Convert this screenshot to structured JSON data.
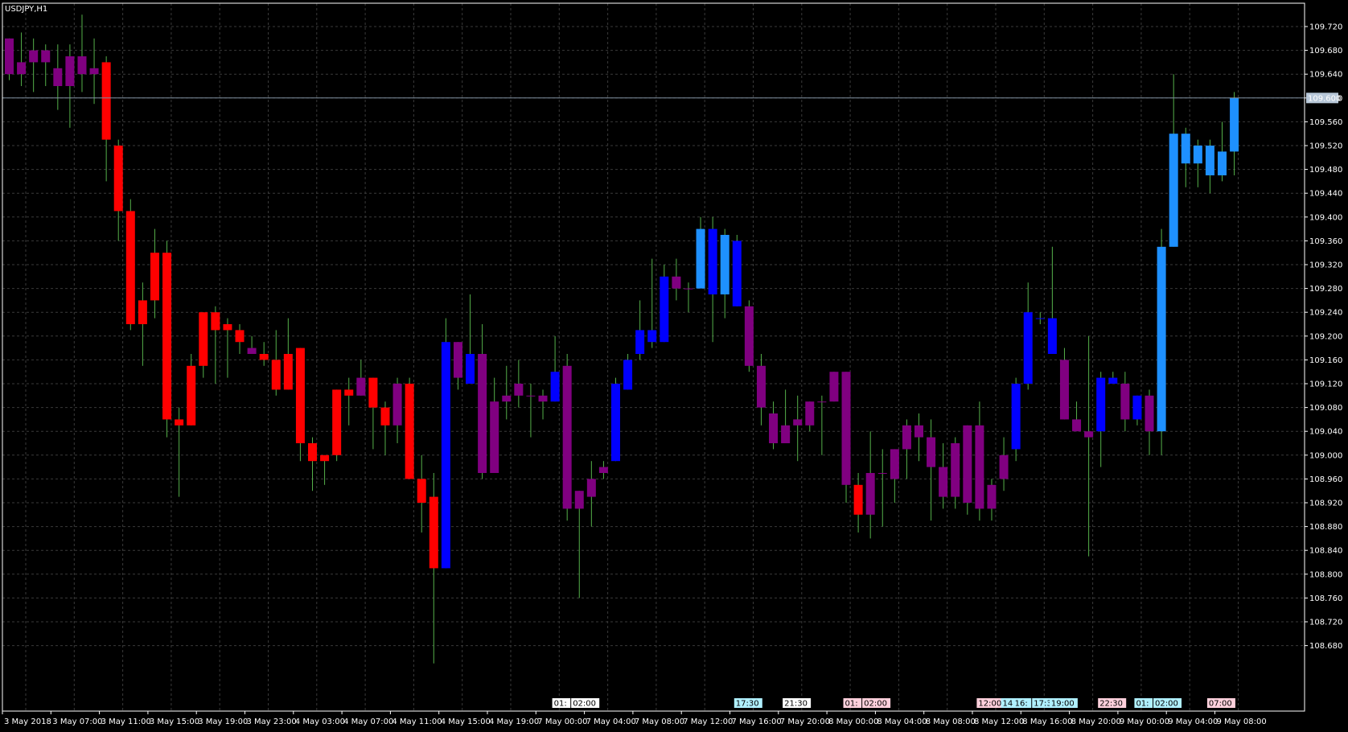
{
  "symbol_label": "USDJPY,H1",
  "current_price_label": "109.600",
  "colors": {
    "background": "#000000",
    "grid": "#3a3a3a",
    "axis": "#ffffff",
    "text": "#ffffff",
    "wick": "#55b04a",
    "bid_line": "#7f8f9f",
    "price_tag_bg": "#b7c7d8",
    "price_tag_text": "#000000",
    "candle_bear_strong": "#ff0000",
    "candle_bull_strong": "#0000ff",
    "candle_bull_light": "#1e90ff",
    "candle_neutral": "#800080"
  },
  "chart_data": {
    "type": "candlestick",
    "title": "USDJPY,H1",
    "ylim": [
      108.64,
      109.74
    ],
    "grid": true,
    "y_ticks": [
      "109.720",
      "109.680",
      "109.640",
      "109.600",
      "109.560",
      "109.520",
      "109.480",
      "109.440",
      "109.400",
      "109.360",
      "109.320",
      "109.280",
      "109.240",
      "109.200",
      "109.160",
      "109.120",
      "109.080",
      "109.040",
      "109.000",
      "108.960",
      "108.920",
      "108.880",
      "108.840",
      "108.800",
      "108.760",
      "108.720",
      "108.680"
    ],
    "x_labels": [
      "3 May 2018",
      "3 May 07:00",
      "3 May 11:00",
      "3 May 15:00",
      "3 May 19:00",
      "3 May 23:00",
      "4 May 03:00",
      "4 May 07:00",
      "4 May 11:00",
      "4 May 15:00",
      "4 May 19:00",
      "7 May 00:00",
      "7 May 04:00",
      "7 May 08:00",
      "7 May 12:00",
      "7 May 16:00",
      "7 May 20:00",
      "8 May 00:00",
      "8 May 04:00",
      "8 May 08:00",
      "8 May 12:00",
      "8 May 16:00",
      "8 May 20:00",
      "9 May 00:00",
      "9 May 04:00",
      "9 May 08:00"
    ],
    "event_tags": [
      {
        "after_candle": 45,
        "texts": [
          "01:",
          "02:00"
        ],
        "color": "#ffffff"
      },
      {
        "after_candle": 60,
        "texts": [
          "17:30"
        ],
        "color": "#b0f0ff"
      },
      {
        "after_candle": 64,
        "texts": [
          "21:30"
        ],
        "color": "#ffffff"
      },
      {
        "after_candle": 69,
        "texts": [
          "01:",
          "02:00"
        ],
        "color": "#ffd0dc"
      },
      {
        "after_candle": 80,
        "texts": [
          "12:00"
        ],
        "color": "#ffd0dc"
      },
      {
        "after_candle": 82,
        "texts": [
          "14:55"
        ],
        "color": "#b0f0ff"
      },
      {
        "after_candle": 83,
        "texts": [
          "16:",
          "17:30"
        ],
        "color": "#b0f0ff"
      },
      {
        "after_candle": 86,
        "texts": [
          "19:00"
        ],
        "color": "#b0f0ff"
      },
      {
        "after_candle": 90,
        "texts": [
          "22:30"
        ],
        "color": "#ffd0dc"
      },
      {
        "after_candle": 93,
        "texts": [
          "01:",
          "02:00"
        ],
        "color": "#b0f0ff"
      },
      {
        "after_candle": 99,
        "texts": [
          "07:00"
        ],
        "color": "#ffd0dc"
      }
    ],
    "candles": [
      {
        "o": 109.7,
        "h": 109.7,
        "l": 109.63,
        "c": 109.64,
        "k": "p"
      },
      {
        "o": 109.64,
        "h": 109.71,
        "l": 109.62,
        "c": 109.66,
        "k": "p"
      },
      {
        "o": 109.68,
        "h": 109.7,
        "l": 109.61,
        "c": 109.66,
        "k": "p"
      },
      {
        "o": 109.66,
        "h": 109.69,
        "l": 109.62,
        "c": 109.68,
        "k": "p"
      },
      {
        "o": 109.65,
        "h": 109.69,
        "l": 109.58,
        "c": 109.62,
        "k": "p"
      },
      {
        "o": 109.62,
        "h": 109.69,
        "l": 109.55,
        "c": 109.67,
        "k": "p"
      },
      {
        "o": 109.67,
        "h": 109.74,
        "l": 109.61,
        "c": 109.64,
        "k": "p"
      },
      {
        "o": 109.64,
        "h": 109.7,
        "l": 109.59,
        "c": 109.65,
        "k": "p"
      },
      {
        "o": 109.66,
        "h": 109.67,
        "l": 109.46,
        "c": 109.53,
        "k": "r"
      },
      {
        "o": 109.52,
        "h": 109.53,
        "l": 109.36,
        "c": 109.41,
        "k": "r"
      },
      {
        "o": 109.41,
        "h": 109.43,
        "l": 109.21,
        "c": 109.22,
        "k": "r"
      },
      {
        "o": 109.22,
        "h": 109.29,
        "l": 109.15,
        "c": 109.26,
        "k": "r"
      },
      {
        "o": 109.34,
        "h": 109.38,
        "l": 109.23,
        "c": 109.26,
        "k": "r"
      },
      {
        "o": 109.34,
        "h": 109.36,
        "l": 109.03,
        "c": 109.06,
        "k": "r"
      },
      {
        "o": 109.06,
        "h": 109.08,
        "l": 108.93,
        "c": 109.05,
        "k": "r"
      },
      {
        "o": 109.05,
        "h": 109.17,
        "l": 109.05,
        "c": 109.15,
        "k": "r"
      },
      {
        "o": 109.15,
        "h": 109.24,
        "l": 109.13,
        "c": 109.24,
        "k": "r"
      },
      {
        "o": 109.24,
        "h": 109.25,
        "l": 109.12,
        "c": 109.21,
        "k": "r"
      },
      {
        "o": 109.22,
        "h": 109.23,
        "l": 109.13,
        "c": 109.21,
        "k": "r"
      },
      {
        "o": 109.21,
        "h": 109.22,
        "l": 109.17,
        "c": 109.19,
        "k": "r"
      },
      {
        "o": 109.18,
        "h": 109.2,
        "l": 109.17,
        "c": 109.17,
        "k": "p"
      },
      {
        "o": 109.17,
        "h": 109.19,
        "l": 109.15,
        "c": 109.16,
        "k": "r"
      },
      {
        "o": 109.16,
        "h": 109.21,
        "l": 109.1,
        "c": 109.11,
        "k": "r"
      },
      {
        "o": 109.17,
        "h": 109.23,
        "l": 109.11,
        "c": 109.11,
        "k": "r"
      },
      {
        "o": 109.18,
        "h": 109.18,
        "l": 108.99,
        "c": 109.02,
        "k": "r"
      },
      {
        "o": 109.02,
        "h": 109.03,
        "l": 108.94,
        "c": 108.99,
        "k": "r"
      },
      {
        "o": 108.99,
        "h": 109.0,
        "l": 108.95,
        "c": 109.0,
        "k": "r"
      },
      {
        "o": 109.0,
        "h": 109.11,
        "l": 108.99,
        "c": 109.11,
        "k": "r"
      },
      {
        "o": 109.11,
        "h": 109.13,
        "l": 109.05,
        "c": 109.1,
        "k": "r"
      },
      {
        "o": 109.1,
        "h": 109.16,
        "l": 109.1,
        "c": 109.13,
        "k": "p"
      },
      {
        "o": 109.13,
        "h": 109.13,
        "l": 109.01,
        "c": 109.08,
        "k": "r"
      },
      {
        "o": 109.08,
        "h": 109.09,
        "l": 109.0,
        "c": 109.05,
        "k": "r"
      },
      {
        "o": 109.05,
        "h": 109.13,
        "l": 109.02,
        "c": 109.12,
        "k": "p"
      },
      {
        "o": 109.12,
        "h": 109.13,
        "l": 108.96,
        "c": 108.96,
        "k": "r"
      },
      {
        "o": 108.96,
        "h": 109.0,
        "l": 108.87,
        "c": 108.92,
        "k": "r"
      },
      {
        "o": 108.93,
        "h": 108.97,
        "l": 108.65,
        "c": 108.81,
        "k": "r"
      },
      {
        "o": 108.81,
        "h": 109.23,
        "l": 108.81,
        "c": 109.19,
        "k": "b"
      },
      {
        "o": 109.19,
        "h": 109.19,
        "l": 109.11,
        "c": 109.13,
        "k": "p"
      },
      {
        "o": 109.12,
        "h": 109.27,
        "l": 109.12,
        "c": 109.17,
        "k": "b"
      },
      {
        "o": 109.17,
        "h": 109.22,
        "l": 108.96,
        "c": 108.97,
        "k": "p"
      },
      {
        "o": 108.97,
        "h": 109.13,
        "l": 108.97,
        "c": 109.09,
        "k": "p"
      },
      {
        "o": 109.09,
        "h": 109.15,
        "l": 109.06,
        "c": 109.1,
        "k": "p"
      },
      {
        "o": 109.12,
        "h": 109.16,
        "l": 109.08,
        "c": 109.1,
        "k": "p"
      },
      {
        "o": 109.1,
        "h": 109.12,
        "l": 109.03,
        "c": 109.1,
        "k": "p"
      },
      {
        "o": 109.09,
        "h": 109.11,
        "l": 109.06,
        "c": 109.1,
        "k": "p"
      },
      {
        "o": 109.09,
        "h": 109.2,
        "l": 109.09,
        "c": 109.14,
        "k": "b"
      },
      {
        "o": 109.15,
        "h": 109.17,
        "l": 108.89,
        "c": 108.91,
        "k": "p"
      },
      {
        "o": 108.91,
        "h": 108.94,
        "l": 108.76,
        "c": 108.94,
        "k": "p"
      },
      {
        "o": 108.93,
        "h": 108.99,
        "l": 108.88,
        "c": 108.96,
        "k": "p"
      },
      {
        "o": 108.97,
        "h": 108.99,
        "l": 108.96,
        "c": 108.98,
        "k": "p"
      },
      {
        "o": 108.99,
        "h": 109.13,
        "l": 108.99,
        "c": 109.12,
        "k": "b"
      },
      {
        "o": 109.11,
        "h": 109.17,
        "l": 109.11,
        "c": 109.16,
        "k": "b"
      },
      {
        "o": 109.17,
        "h": 109.26,
        "l": 109.16,
        "c": 109.21,
        "k": "b"
      },
      {
        "o": 109.19,
        "h": 109.33,
        "l": 109.18,
        "c": 109.21,
        "k": "b"
      },
      {
        "o": 109.19,
        "h": 109.32,
        "l": 109.19,
        "c": 109.3,
        "k": "b"
      },
      {
        "o": 109.3,
        "h": 109.33,
        "l": 109.26,
        "c": 109.28,
        "k": "p"
      },
      {
        "o": 109.28,
        "h": 109.29,
        "l": 109.24,
        "c": 109.28,
        "k": "p"
      },
      {
        "o": 109.28,
        "h": 109.4,
        "l": 109.28,
        "c": 109.38,
        "k": "l"
      },
      {
        "o": 109.27,
        "h": 109.4,
        "l": 109.19,
        "c": 109.38,
        "k": "b"
      },
      {
        "o": 109.27,
        "h": 109.38,
        "l": 109.23,
        "c": 109.37,
        "k": "l"
      },
      {
        "o": 109.25,
        "h": 109.37,
        "l": 109.25,
        "c": 109.36,
        "k": "b"
      },
      {
        "o": 109.25,
        "h": 109.26,
        "l": 109.14,
        "c": 109.15,
        "k": "p"
      },
      {
        "o": 109.15,
        "h": 109.17,
        "l": 109.05,
        "c": 109.08,
        "k": "p"
      },
      {
        "o": 109.07,
        "h": 109.09,
        "l": 109.01,
        "c": 109.02,
        "k": "p"
      },
      {
        "o": 109.02,
        "h": 109.11,
        "l": 109.02,
        "c": 109.05,
        "k": "p"
      },
      {
        "o": 109.05,
        "h": 109.1,
        "l": 108.99,
        "c": 109.06,
        "k": "p"
      },
      {
        "o": 109.05,
        "h": 109.09,
        "l": 109.04,
        "c": 109.09,
        "k": "p"
      },
      {
        "o": 109.09,
        "h": 109.1,
        "l": 109.0,
        "c": 109.09,
        "k": "p"
      },
      {
        "o": 109.09,
        "h": 109.14,
        "l": 109.09,
        "c": 109.14,
        "k": "p"
      },
      {
        "o": 109.14,
        "h": 109.14,
        "l": 108.92,
        "c": 108.95,
        "k": "p"
      },
      {
        "o": 108.95,
        "h": 108.97,
        "l": 108.87,
        "c": 108.9,
        "k": "r"
      },
      {
        "o": 108.9,
        "h": 109.04,
        "l": 108.86,
        "c": 108.97,
        "k": "p"
      },
      {
        "o": 108.97,
        "h": 109.01,
        "l": 108.88,
        "c": 108.97,
        "k": "p"
      },
      {
        "o": 108.96,
        "h": 109.01,
        "l": 108.92,
        "c": 109.01,
        "k": "p"
      },
      {
        "o": 109.01,
        "h": 109.06,
        "l": 108.96,
        "c": 109.05,
        "k": "p"
      },
      {
        "o": 109.05,
        "h": 109.07,
        "l": 108.99,
        "c": 109.03,
        "k": "p"
      },
      {
        "o": 109.03,
        "h": 109.06,
        "l": 108.89,
        "c": 108.98,
        "k": "p"
      },
      {
        "o": 108.98,
        "h": 109.02,
        "l": 108.91,
        "c": 108.93,
        "k": "p"
      },
      {
        "o": 108.93,
        "h": 109.03,
        "l": 108.91,
        "c": 109.02,
        "k": "p"
      },
      {
        "o": 109.05,
        "h": 109.05,
        "l": 108.9,
        "c": 108.92,
        "k": "p"
      },
      {
        "o": 108.91,
        "h": 109.09,
        "l": 108.89,
        "c": 109.05,
        "k": "p"
      },
      {
        "o": 108.91,
        "h": 108.96,
        "l": 108.89,
        "c": 108.95,
        "k": "p"
      },
      {
        "o": 108.96,
        "h": 109.03,
        "l": 108.94,
        "c": 109.0,
        "k": "p"
      },
      {
        "o": 109.01,
        "h": 109.13,
        "l": 108.99,
        "c": 109.12,
        "k": "b"
      },
      {
        "o": 109.12,
        "h": 109.29,
        "l": 109.11,
        "c": 109.24,
        "k": "b"
      },
      {
        "o": 109.23,
        "h": 109.24,
        "l": 109.22,
        "c": 109.23,
        "k": "b"
      },
      {
        "o": 109.23,
        "h": 109.35,
        "l": 109.17,
        "c": 109.17,
        "k": "b"
      },
      {
        "o": 109.16,
        "h": 109.18,
        "l": 109.06,
        "c": 109.06,
        "k": "p"
      },
      {
        "o": 109.06,
        "h": 109.09,
        "l": 109.04,
        "c": 109.04,
        "k": "p"
      },
      {
        "o": 109.04,
        "h": 109.2,
        "l": 108.83,
        "c": 109.03,
        "k": "p"
      },
      {
        "o": 109.04,
        "h": 109.14,
        "l": 108.98,
        "c": 109.13,
        "k": "b"
      },
      {
        "o": 109.13,
        "h": 109.14,
        "l": 109.12,
        "c": 109.12,
        "k": "b"
      },
      {
        "o": 109.12,
        "h": 109.14,
        "l": 109.04,
        "c": 109.06,
        "k": "p"
      },
      {
        "o": 109.1,
        "h": 109.1,
        "l": 109.05,
        "c": 109.06,
        "k": "b"
      },
      {
        "o": 109.1,
        "h": 109.11,
        "l": 109.0,
        "c": 109.04,
        "k": "p"
      },
      {
        "o": 109.04,
        "h": 109.38,
        "l": 109.0,
        "c": 109.35,
        "k": "l"
      },
      {
        "o": 109.35,
        "h": 109.64,
        "l": 109.35,
        "c": 109.54,
        "k": "l"
      },
      {
        "o": 109.54,
        "h": 109.55,
        "l": 109.45,
        "c": 109.49,
        "k": "l"
      },
      {
        "o": 109.49,
        "h": 109.53,
        "l": 109.45,
        "c": 109.52,
        "k": "l"
      },
      {
        "o": 109.52,
        "h": 109.53,
        "l": 109.44,
        "c": 109.47,
        "k": "l"
      },
      {
        "o": 109.47,
        "h": 109.56,
        "l": 109.46,
        "c": 109.51,
        "k": "l"
      },
      {
        "o": 109.51,
        "h": 109.61,
        "l": 109.47,
        "c": 109.6,
        "k": "l"
      }
    ]
  }
}
